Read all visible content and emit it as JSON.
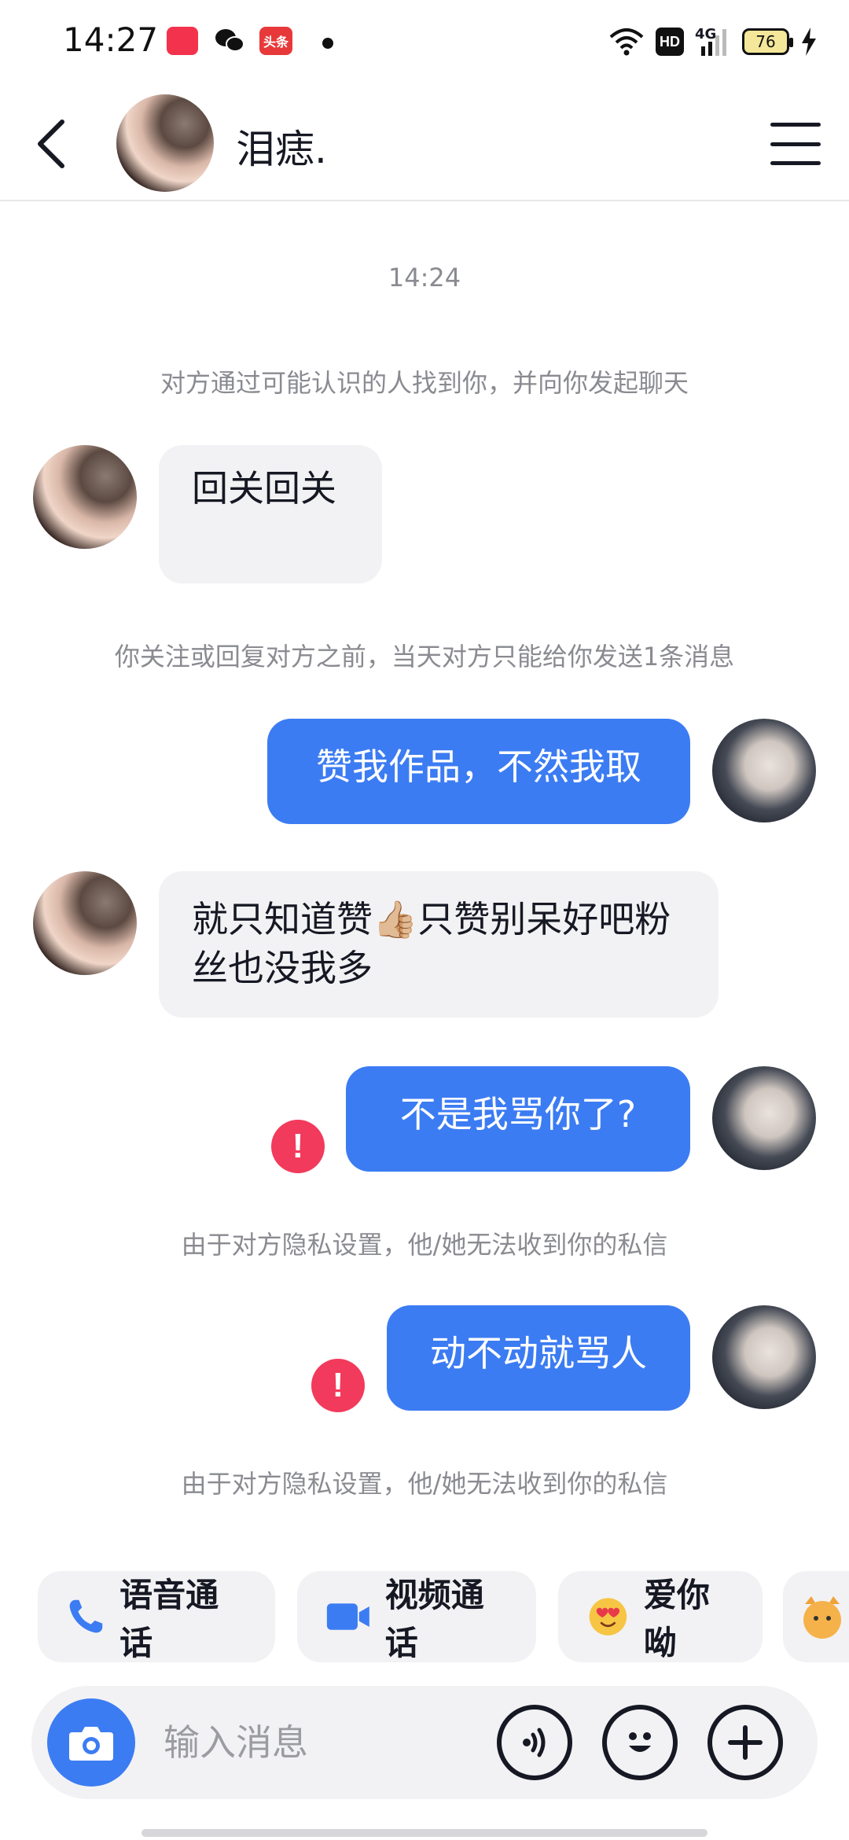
{
  "status_bar": {
    "time": "14:27",
    "app_badge_toutiao": "头条",
    "network": "4G",
    "hd": "HD",
    "battery": "76"
  },
  "header": {
    "title": "泪痣.",
    "back_icon": "chevron-left-icon",
    "menu_icon": "hamburger-menu-icon"
  },
  "chat": {
    "timestamp": "14:24",
    "system_intro": "对方通过可能认识的人找到你，并向你发起聊天",
    "messages": [
      {
        "side": "in",
        "text": "回关回关"
      },
      {
        "side": "system",
        "text": "你关注或回复对方之前，当天对方只能给你发送1条消息"
      },
      {
        "side": "out",
        "text": "赞我作品，不然我取"
      },
      {
        "side": "in",
        "text": "就只知道赞👍🏼只赞别呆好吧粉丝也没我多"
      },
      {
        "side": "out",
        "text": "不是我骂你了?",
        "failed": true
      },
      {
        "side": "system",
        "text": "由于对方隐私设置，他/她无法收到你的私信"
      },
      {
        "side": "out",
        "text": "动不动就骂人",
        "failed": true
      },
      {
        "side": "system",
        "text": "由于对方隐私设置，他/她无法收到你的私信"
      }
    ]
  },
  "quick_actions": [
    {
      "label": "语音通话",
      "icon": "phone-icon"
    },
    {
      "label": "视频通话",
      "icon": "video-camera-icon"
    },
    {
      "label": "爱你呦",
      "icon": "heart-eyes-emoji-icon"
    },
    {
      "label": "",
      "icon": "cat-sticker-icon"
    }
  ],
  "input_bar": {
    "placeholder": "输入消息",
    "camera_icon": "camera-icon",
    "voice_icon": "voice-wave-icon",
    "emoji_icon": "smiley-icon",
    "plus_icon": "plus-icon"
  },
  "colors": {
    "accent": "#3c7cf3",
    "error": "#f23a5c",
    "bubble_in": "#f2f2f4"
  }
}
